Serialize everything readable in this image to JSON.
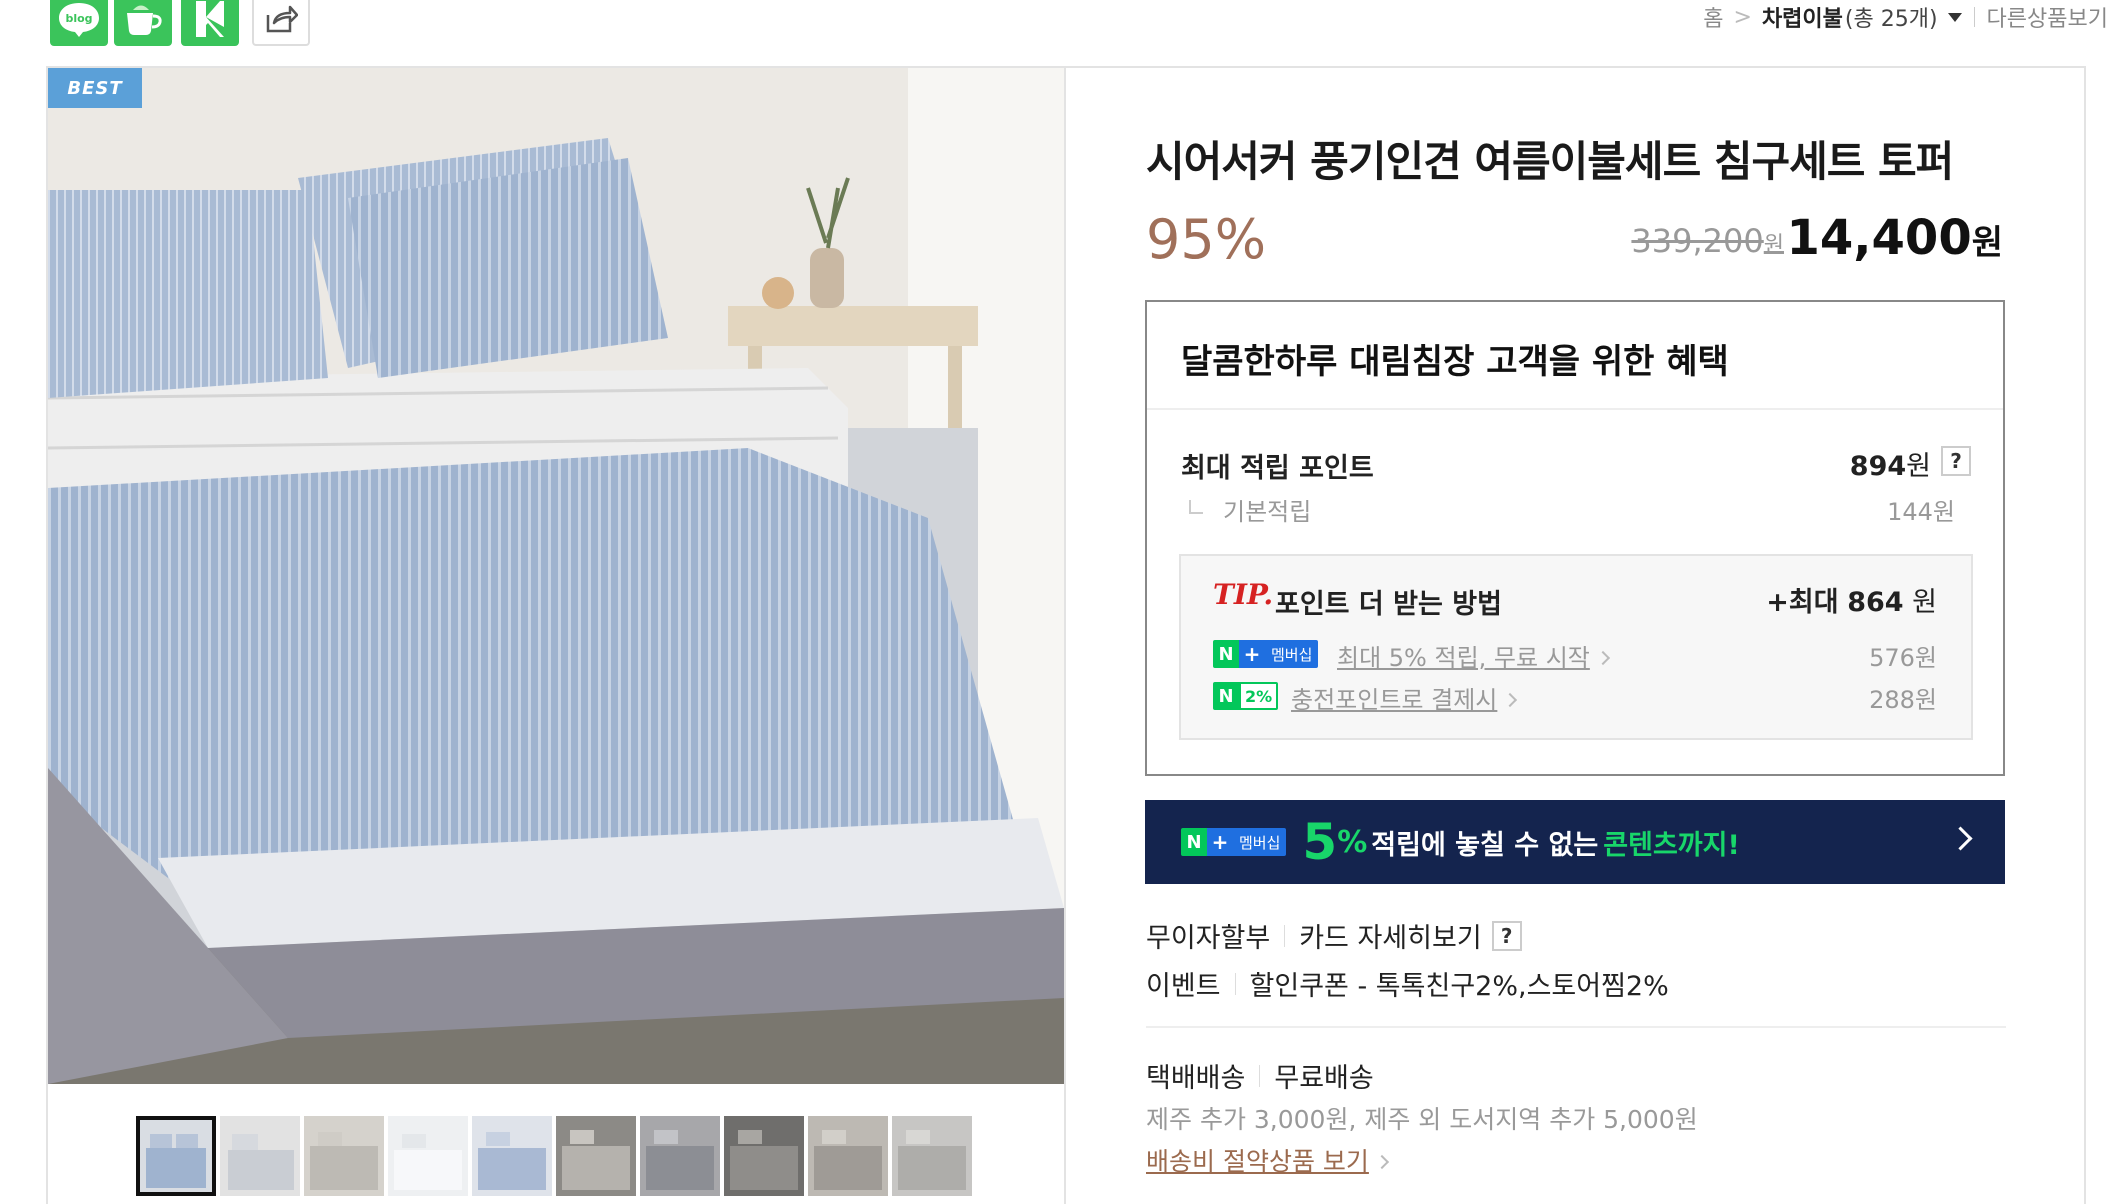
{
  "share": {
    "blog_label": "blog",
    "icons": [
      "blog-icon",
      "cafe-cup-icon",
      "kakao-story-icon",
      "share-icon"
    ]
  },
  "breadcrumb": {
    "home": "홈",
    "separator": ">",
    "category": "차렵이불",
    "count": "(총 25개)",
    "other": "다른상품보기"
  },
  "product": {
    "badge": "BEST",
    "title": "시어서커 풍기인견 여름이불세트 침구세트 토퍼",
    "discount": "95%",
    "original_price": "339,200",
    "original_unit": "원",
    "price": "14,400",
    "price_unit": "원",
    "thumbnail_count": 10,
    "selected_thumbnail": 1
  },
  "benefit": {
    "title": "달콤한하루 대림침장 고객을 위한 혜택",
    "max_point_label": "최대 적립 포인트",
    "max_point_value": "894",
    "max_point_unit": "원",
    "help_label": "?",
    "base_label": "기본적립",
    "base_value": "144원",
    "tip": {
      "label": "TIP.",
      "text": "포인트 더 받는 방법",
      "max_prefix": "+최대",
      "max_value": "864",
      "max_unit": "원",
      "rows": [
        {
          "badge_n": "N",
          "badge_plus": "+",
          "badge_text": "멤버십",
          "link": "최대 5% 적립, 무료 시작",
          "amount": "576원"
        },
        {
          "badge_n": "N",
          "badge_text": "2%",
          "link": "충전포인트로 결제시",
          "amount": "288원"
        }
      ]
    }
  },
  "banner": {
    "badge_n": "N",
    "badge_plus": "+",
    "badge_text": "멤버십",
    "big_number": "5",
    "percent": "%",
    "text": "적립에 놓칠 수 없는",
    "highlight": "콘텐츠까지!"
  },
  "payment": {
    "installment": "무이자할부",
    "card_details": "카드 자세히보기",
    "help": "?",
    "event_label": "이벤트",
    "event_text": "할인쿠폰 - 톡톡친구2%,스토어찜2%"
  },
  "shipping": {
    "method": "택배배송",
    "fee": "무료배송",
    "note": "제주 추가 3,000원, 제주 외 도서지역 추가 5,000원",
    "link": "배송비 절약상품 보기"
  },
  "colors": {
    "discount": "#a0705a",
    "naver_green": "#03c75a",
    "banner_bg": "#14244e",
    "best_badge": "#5ba0d8",
    "tip_red": "#d62222"
  }
}
